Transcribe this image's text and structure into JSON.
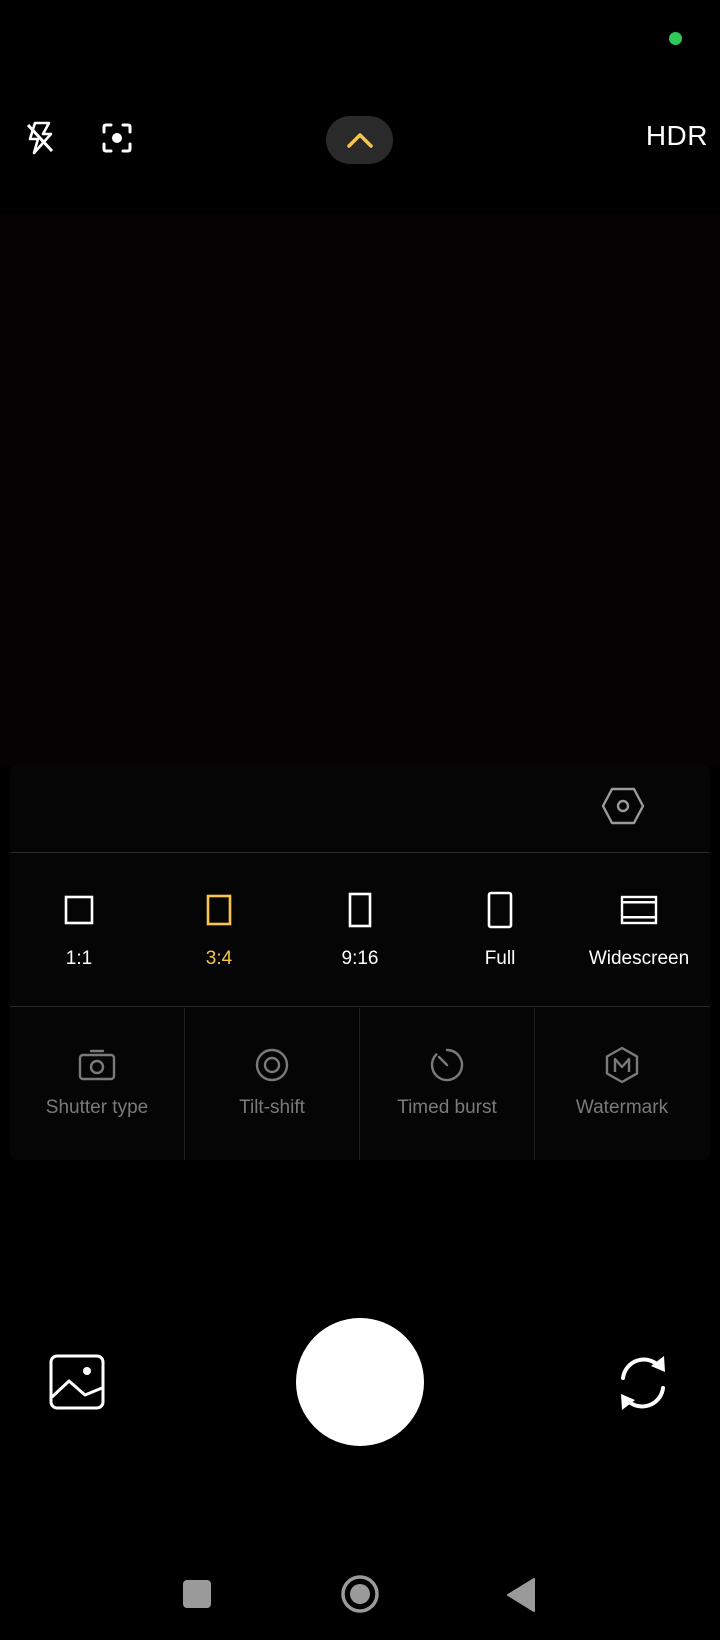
{
  "status": {
    "indicator_color": "#2fc95a"
  },
  "toolbar": {
    "flash_icon": "flash-off-icon",
    "focus_icon": "focus-frame-icon",
    "expand_icon": "chevron-up-icon",
    "hdr_label": "HDR"
  },
  "settings_panel": {
    "settings_icon": "hexagon-settings-icon",
    "aspect_ratios": [
      {
        "label": "1:1",
        "icon": "square-icon",
        "selected": false
      },
      {
        "label": "3:4",
        "icon": "portrait-rect-icon",
        "selected": true
      },
      {
        "label": "9:16",
        "icon": "tall-rect-icon",
        "selected": false
      },
      {
        "label": "Full",
        "icon": "full-rect-icon",
        "selected": false
      },
      {
        "label": "Widescreen",
        "icon": "widescreen-icon",
        "selected": false
      }
    ],
    "options": [
      {
        "label": "Shutter type",
        "icon": "camera-icon"
      },
      {
        "label": "Tilt-shift",
        "icon": "tilt-shift-icon"
      },
      {
        "label": "Timed burst",
        "icon": "timer-icon"
      },
      {
        "label": "Watermark",
        "icon": "watermark-icon"
      }
    ]
  },
  "bottom_controls": {
    "gallery_icon": "gallery-icon",
    "shutter": "shutter-button",
    "switch_icon": "switch-camera-icon"
  },
  "nav_bar": {
    "recents_icon": "recents-icon",
    "home_icon": "home-icon",
    "back_icon": "back-icon"
  },
  "colors": {
    "accent": "#f5c64a",
    "background": "#000000",
    "muted_text": "#7a7a7a"
  }
}
